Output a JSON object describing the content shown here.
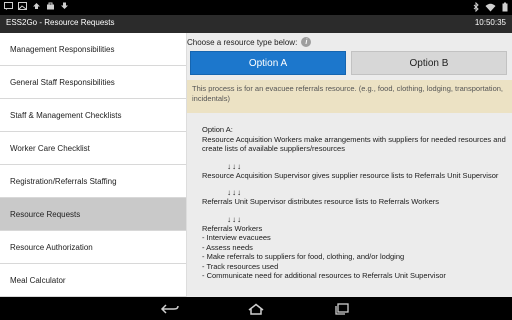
{
  "status": {
    "time": "10:50:35"
  },
  "app": {
    "title": "ESS2Go - Resource Requests"
  },
  "sidebar": {
    "items": [
      {
        "label": "Management Responsibilities"
      },
      {
        "label": "General Staff Responsibilities"
      },
      {
        "label": "Staff & Management Checklists"
      },
      {
        "label": "Worker Care Checklist"
      },
      {
        "label": "Registration/Referrals Staffing"
      },
      {
        "label": "Resource Requests"
      },
      {
        "label": "Resource Authorization"
      },
      {
        "label": "Meal Calculator"
      }
    ],
    "selected": "Resource Requests"
  },
  "main": {
    "prompt": "Choose a resource type below:",
    "info_icon_text": "i",
    "option_a": "Option A",
    "option_b": "Option B",
    "notice": "This process is for an evacuee referrals resource. (e.g., food, clothing, lodging, transportation, incidentals)",
    "content": {
      "heading": "Option A:",
      "step1": "Resource Acquisition Workers make arrangements with suppliers for needed resources and create lists of available suppliers/resources",
      "arrows": "↓↓↓",
      "step2": "Resource Acquisition Supervisor gives supplier resource lists to Referrals Unit Supervisor",
      "step3": "Referrals Unit Supervisor distributes resource lists to Referrals Workers",
      "step4_title": "Referrals Workers",
      "step4_items": [
        "- Interview evacuees",
        "- Assess needs",
        "- Make referrals to suppliers for food, clothing, and/or lodging",
        "- Track resources used",
        "- Communicate need for additional resources to Referrals Unit Supervisor"
      ]
    }
  },
  "colors": {
    "selected_option": "#1c77cc",
    "notice_bg": "#ece2c4",
    "sidebar_selected": "#c9c9c9"
  }
}
